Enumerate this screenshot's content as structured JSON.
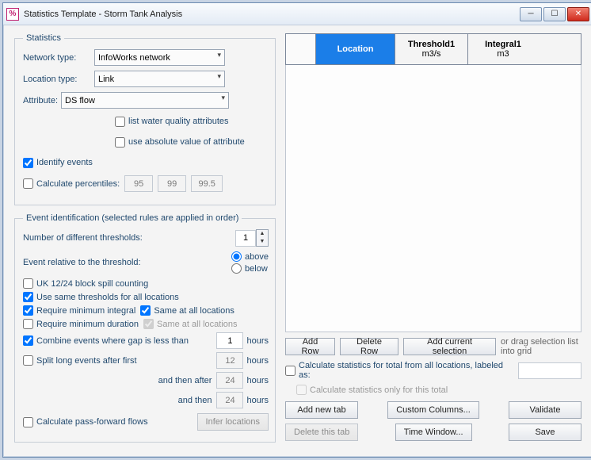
{
  "window": {
    "title": "Statistics Template - Storm Tank Analysis"
  },
  "stats": {
    "legend": "Statistics",
    "network_label": "Network type:",
    "network_value": "InfoWorks network",
    "location_label": "Location type:",
    "location_value": "Link",
    "attribute_label": "Attribute:",
    "attribute_value": "DS flow",
    "chk_list_wq": "list water quality attributes",
    "chk_use_abs": "use absolute value of attribute",
    "chk_identify": "Identify events",
    "chk_percentiles": "Calculate percentiles:",
    "pct1": "95",
    "pct2": "99",
    "pct3": "99.5"
  },
  "eid": {
    "legend": "Event identification (selected rules are applied in order)",
    "thresh_count_label": "Number of different thresholds:",
    "thresh_count": "1",
    "relative_label": "Event relative to the threshold:",
    "radio_above": "above",
    "radio_below": "below",
    "chk_uk": "UK 12/24 block spill counting",
    "chk_same_thresh": "Use same thresholds for all locations",
    "chk_req_int": "Require minimum integral",
    "chk_same_int": "Same at all locations",
    "chk_req_dur": "Require minimum duration",
    "chk_same_dur": "Same at all locations",
    "chk_combine": "Combine events where gap is less than",
    "combine_val": "1",
    "chk_split": "Split long events after first",
    "split1": "12",
    "split2": "24",
    "split3": "24",
    "split_after": "and then after",
    "split_then": "and then",
    "hours": "hours",
    "chk_passfwd": "Calculate pass-forward flows",
    "btn_inferloc": "Infer locations"
  },
  "grid": {
    "col1": "Location",
    "col2a": "Threshold1",
    "col2b": "m3/s",
    "col3a": "Integral1",
    "col3b": "m3"
  },
  "gridbtns": {
    "addrow": "Add Row",
    "delrow": "Delete Row",
    "addsel": "Add current selection",
    "drag_hint": "or drag selection list into grid",
    "chk_total": "Calculate statistics for total from all locations, labeled as:",
    "chk_total_only": "Calculate statistics only for this total",
    "addtab": "Add new tab",
    "deltab": "Delete this tab",
    "custom": "Custom Columns...",
    "timewin": "Time Window...",
    "validate": "Validate",
    "save": "Save"
  }
}
